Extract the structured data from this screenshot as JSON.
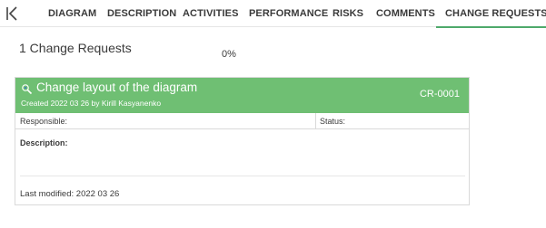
{
  "tabs": [
    {
      "label": "DIAGRAM",
      "active": false
    },
    {
      "label": "DESCRIPTION",
      "active": false
    },
    {
      "label": "ACTIVITIES",
      "active": false
    },
    {
      "label": "PERFORMANCE",
      "active": false
    },
    {
      "label": "RISKS",
      "active": false
    },
    {
      "label": "COMMENTS",
      "active": false
    },
    {
      "label": "CHANGE REQUESTS",
      "active": true
    }
  ],
  "summary": {
    "count_label": "1 Change Requests",
    "progress": "0%"
  },
  "change_request": {
    "icon": "magic-wand-icon",
    "title": "Change layout of the diagram",
    "created": "Created 2022 03 26 by Kirill Kasyanenko",
    "id": "CR-0001",
    "responsible_label": "Responsible:",
    "status_label": "Status:",
    "description_label": "Description:",
    "last_modified": "Last modified: 2022 03 26"
  },
  "colors": {
    "accent": "#4ea96b",
    "card_header": "#6fbf73"
  }
}
